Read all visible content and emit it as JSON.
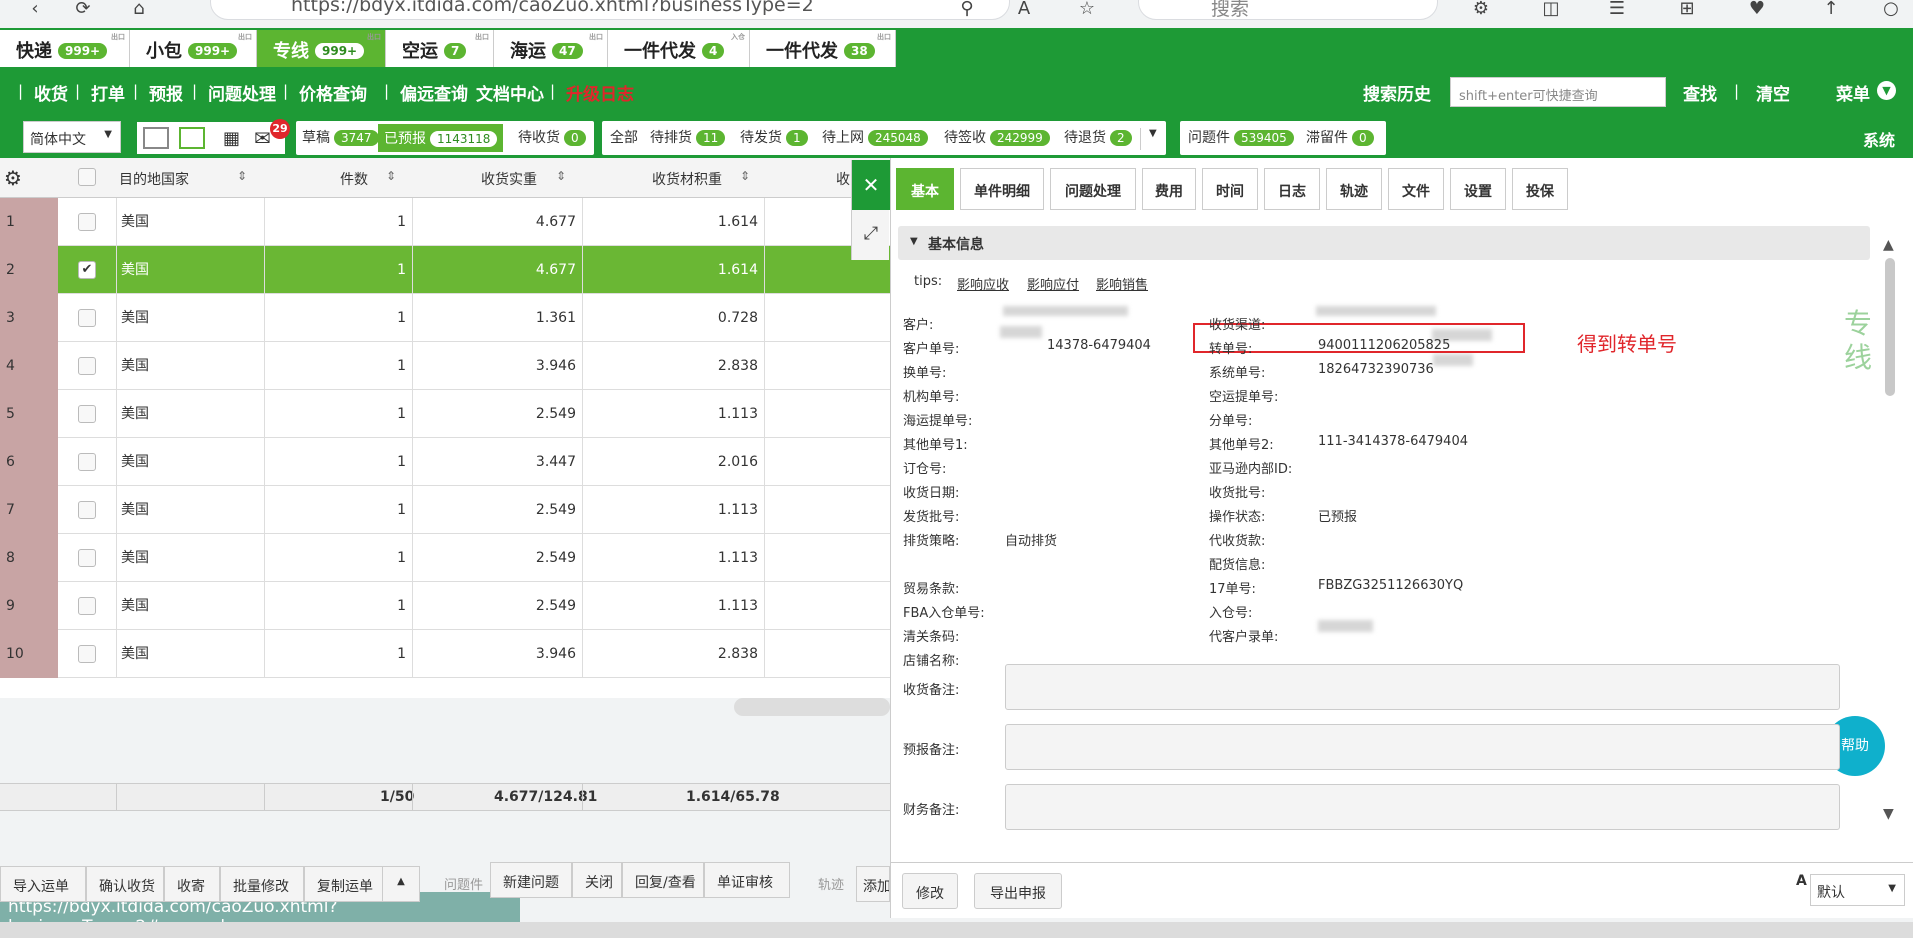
{
  "browser": {
    "url": "https://bdyx.itdida.com/caoZuo.xhtml?businessType=2",
    "search_placeholder": "搜索"
  },
  "top_tabs": [
    {
      "label": "快递",
      "badge": "999+",
      "tag": "出口"
    },
    {
      "label": "小包",
      "badge": "999+",
      "tag": "出口"
    },
    {
      "label": "专线",
      "badge": "999+",
      "tag": "出口",
      "active": true
    },
    {
      "label": "空运",
      "badge": "7",
      "tag": "出口"
    },
    {
      "label": "海运",
      "badge": "47",
      "tag": "出口"
    },
    {
      "label": "一件代发",
      "badge": "4",
      "tag": "入仓"
    },
    {
      "label": "一件代发",
      "badge": "38",
      "tag": "出口"
    }
  ],
  "menu": [
    "收货",
    "打单",
    "预报",
    "问题处理",
    "价格查询",
    "偏远查询",
    "文档中心",
    "升级日志"
  ],
  "menu_right": {
    "history": "搜索历史",
    "quick_placeholder": "shift+enter可快捷查询",
    "find": "查找",
    "clear": "清空",
    "menu": "菜单"
  },
  "filters": {
    "language": "简体中文",
    "mail_count": "29",
    "group1": [
      {
        "label": "草稿",
        "count": "3747"
      },
      {
        "label": "已预报",
        "count": "1143118",
        "selected": true
      },
      {
        "label": "待收货",
        "count": "0"
      }
    ],
    "group2": [
      {
        "label": "全部",
        "count": ""
      },
      {
        "label": "待排货",
        "count": "11"
      },
      {
        "label": "待发货",
        "count": "1"
      },
      {
        "label": "待上网",
        "count": "245048"
      },
      {
        "label": "待签收",
        "count": "242999"
      },
      {
        "label": "待退货",
        "count": "2"
      }
    ],
    "group3": [
      {
        "label": "问题件",
        "count": "539405"
      },
      {
        "label": "滞留件",
        "count": "0"
      }
    ],
    "system": "系统"
  },
  "grid": {
    "headers": [
      "目的地国家",
      "件数",
      "收货实重",
      "收货材积重",
      "收"
    ],
    "rows": [
      {
        "no": "1",
        "country": "美国",
        "pieces": "1",
        "weight": "4.677",
        "volume": "1.614"
      },
      {
        "no": "2",
        "country": "美国",
        "pieces": "1",
        "weight": "4.677",
        "volume": "1.614",
        "selected": true
      },
      {
        "no": "3",
        "country": "美国",
        "pieces": "1",
        "weight": "1.361",
        "volume": "0.728"
      },
      {
        "no": "4",
        "country": "美国",
        "pieces": "1",
        "weight": "3.946",
        "volume": "2.838"
      },
      {
        "no": "5",
        "country": "美国",
        "pieces": "1",
        "weight": "2.549",
        "volume": "1.113"
      },
      {
        "no": "6",
        "country": "美国",
        "pieces": "1",
        "weight": "3.447",
        "volume": "2.016"
      },
      {
        "no": "7",
        "country": "美国",
        "pieces": "1",
        "weight": "2.549",
        "volume": "1.113"
      },
      {
        "no": "8",
        "country": "美国",
        "pieces": "1",
        "weight": "2.549",
        "volume": "1.113"
      },
      {
        "no": "9",
        "country": "美国",
        "pieces": "1",
        "weight": "2.549",
        "volume": "1.113"
      },
      {
        "no": "10",
        "country": "美国",
        "pieces": "1",
        "weight": "3.946",
        "volume": "2.838"
      }
    ],
    "summary": {
      "pieces": "1/50",
      "weight": "4.677/124.81",
      "volume": "1.614/65.78"
    }
  },
  "bottom_toolbar": {
    "buttons": [
      "导入运单",
      "确认收货",
      "收寄",
      "批量修改",
      "复制运单"
    ],
    "problem_label": "问题件",
    "problem_buttons": [
      "新建问题",
      "关闭",
      "回复/查看",
      "单证审核"
    ],
    "track_label": "轨迹",
    "track_button": "添加"
  },
  "status_url": "https://bdyx.itdida.com/caoZuo.xhtml?businessType=2#general",
  "panel": {
    "tabs": [
      "基本",
      "单件明细",
      "问题处理",
      "费用",
      "时间",
      "日志",
      "轨迹",
      "文件",
      "设置",
      "投保"
    ],
    "section_title": "基本信息",
    "tips_label": "tips:",
    "tips_links": [
      "影响应收",
      "影响应付",
      "影响销售"
    ],
    "left_fields": [
      {
        "label": "客户:",
        "value": ""
      },
      {
        "label": "客户单号:",
        "value": "14378-6479404"
      },
      {
        "label": "换单号:",
        "value": ""
      },
      {
        "label": "机构单号:",
        "value": ""
      },
      {
        "label": "海运提单号:",
        "value": ""
      },
      {
        "label": "其他单号1:",
        "value": ""
      },
      {
        "label": "订仓号:",
        "value": ""
      },
      {
        "label": "收货日期:",
        "value": ""
      },
      {
        "label": "发货批号:",
        "value": ""
      },
      {
        "label": "排货策略:",
        "value": "自动排货"
      },
      {
        "label": "",
        "value": ""
      },
      {
        "label": "贸易条款:",
        "value": ""
      },
      {
        "label": "FBA入仓单号:",
        "value": ""
      },
      {
        "label": "清关条码:",
        "value": ""
      },
      {
        "label": "店铺名称:",
        "value": ""
      }
    ],
    "right_fields": [
      {
        "label": "收货渠道:",
        "value": ""
      },
      {
        "label": "转单号:",
        "value": "9400111206205825"
      },
      {
        "label": "系统单号:",
        "value": "18264732390736"
      },
      {
        "label": "空运提单号:",
        "value": ""
      },
      {
        "label": "分单号:",
        "value": ""
      },
      {
        "label": "其他单号2:",
        "value": "111-3414378-6479404"
      },
      {
        "label": "亚马逊内部ID:",
        "value": ""
      },
      {
        "label": "收货批号:",
        "value": ""
      },
      {
        "label": "操作状态:",
        "value": "已预报"
      },
      {
        "label": "代收货款:",
        "value": ""
      },
      {
        "label": "配货信息:",
        "value": ""
      },
      {
        "label": "17单号:",
        "value": "FBBZG3251126630YQ"
      },
      {
        "label": "入仓号:",
        "value": ""
      },
      {
        "label": "代客户录单:",
        "value": ""
      }
    ],
    "notes": [
      "收货备注:",
      "预报备注:",
      "财务备注:"
    ],
    "annotation": "得到转单号",
    "side_text": "专线",
    "help": "帮助",
    "buttons": [
      "修改",
      "导出申报"
    ],
    "default_select": "默认"
  }
}
